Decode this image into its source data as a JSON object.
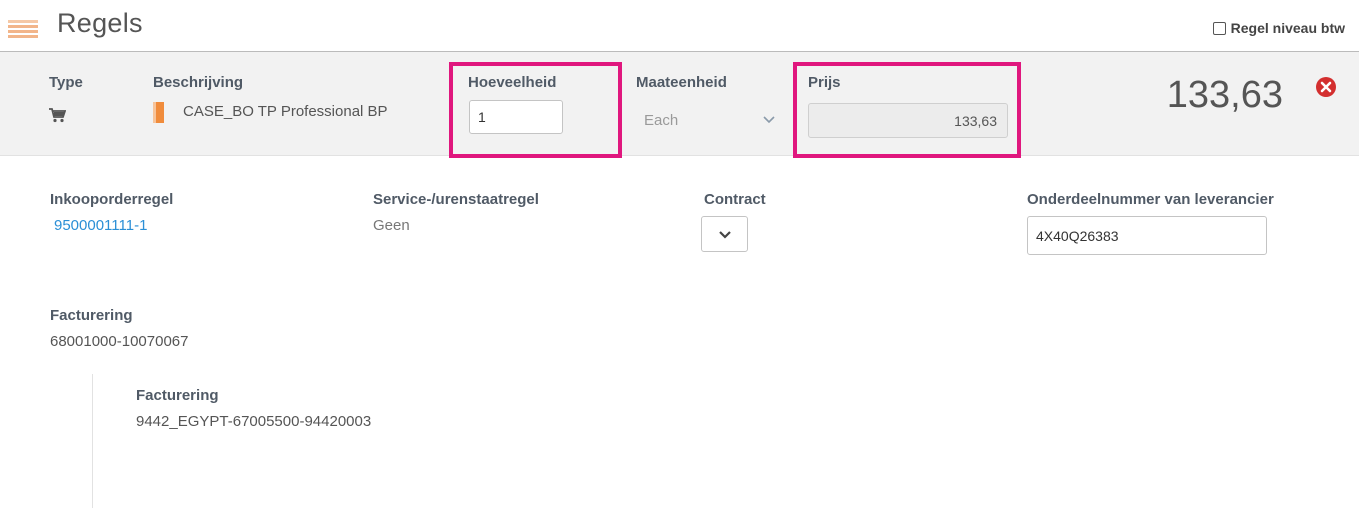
{
  "header": {
    "title": "Regels",
    "vat_checkbox_label": "Regel niveau btw",
    "vat_checked": false
  },
  "line": {
    "type_label": "Type",
    "type_icon": "cart-icon",
    "description_label": "Beschrijving",
    "description_value": "CASE_BO TP Professional BP",
    "quantity_label": "Hoeveelheid",
    "quantity_value": "1",
    "uom_label": "Maateenheid",
    "uom_value": "Each",
    "price_label": "Prijs",
    "price_value": "133,63",
    "total": "133,63",
    "highlight_color": "#e0177e"
  },
  "details": {
    "po_line_label": "Inkooporderregel",
    "po_line_value": "9500001111-1",
    "service_label": "Service-/urenstaatregel",
    "service_value": "Geen",
    "contract_label": "Contract",
    "supplier_part_label": "Onderdeelnummer van leverancier",
    "supplier_part_value": "4X40Q26383",
    "billing_label": "Facturering",
    "billing_value": "68001000-10070067",
    "sub_billing_label": "Facturering",
    "sub_billing_value": "9442_EGYPT-67005500-94420003"
  }
}
